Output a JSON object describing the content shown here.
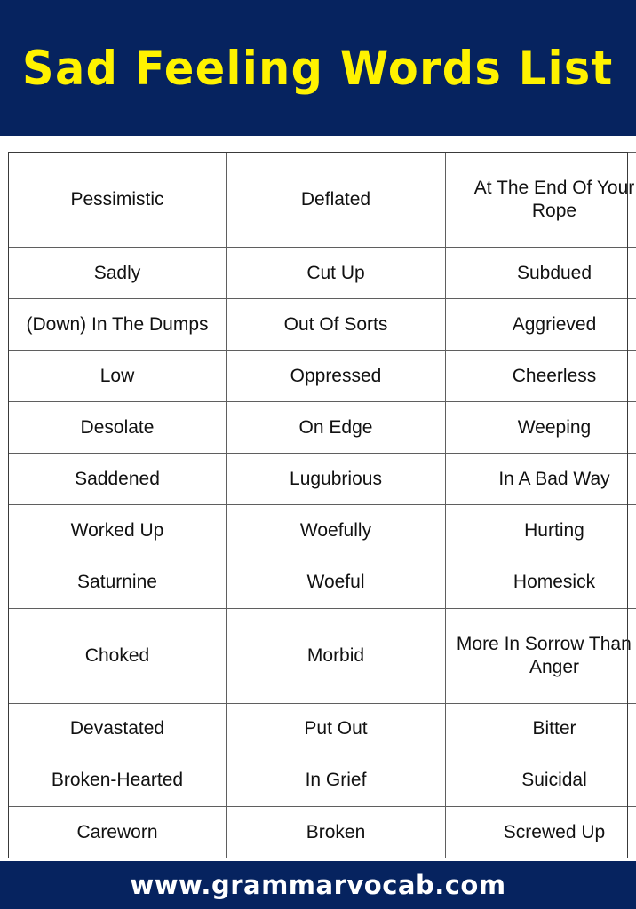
{
  "header": {
    "title": "Sad Feeling Words List",
    "background_color": "#06235f",
    "title_color": "#fff200"
  },
  "footer": {
    "url": "www.grammarvocab.com",
    "background_color": "#06235f",
    "text_color": "#ffffff"
  },
  "table": {
    "border_color": "#5f5f5f",
    "text_color": "#111111",
    "columns": 3,
    "row_count": 12,
    "rows": [
      [
        "Pessimistic",
        "Deflated",
        "At The End Of Your Rope"
      ],
      [
        "Sadly",
        "Cut Up",
        "Subdued"
      ],
      [
        "(Down) In The Dumps",
        "Out Of Sorts",
        "Aggrieved"
      ],
      [
        "Low",
        "Oppressed",
        "Cheerless"
      ],
      [
        "Desolate",
        "On Edge",
        "Weeping"
      ],
      [
        "Saddened",
        "Lugubrious",
        "In A Bad Way"
      ],
      [
        "Worked Up",
        "Woefully",
        "Hurting"
      ],
      [
        "Saturnine",
        "Woeful",
        "Homesick"
      ],
      [
        "Choked",
        "Morbid",
        "More In Sorrow Than In Anger"
      ],
      [
        "Devastated",
        "Put Out",
        "Bitter"
      ],
      [
        "Broken-Hearted",
        "In Grief",
        "Suicidal"
      ],
      [
        "Careworn",
        "Broken",
        "Screwed Up"
      ]
    ]
  }
}
